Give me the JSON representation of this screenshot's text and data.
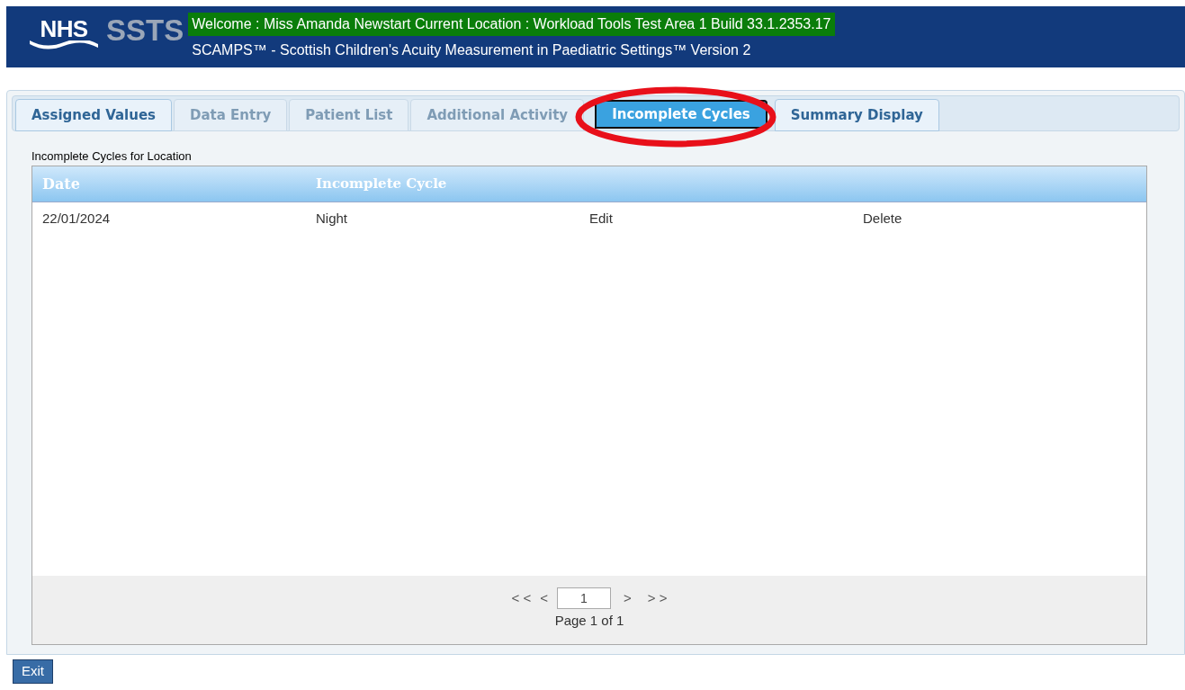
{
  "header": {
    "logo_nhs": "NHS",
    "logo_app": "SSTS",
    "welcome": "Welcome : Miss Amanda Newstart Current Location : Workload Tools Test Area 1 Build 33.1.2353.17",
    "subtitle": "SCAMPS™ - Scottish Children's Acuity Measurement in Paediatric Settings™ Version 2"
  },
  "tabs": [
    {
      "label": "Assigned Values",
      "selected": false,
      "disabled": false
    },
    {
      "label": "Data Entry",
      "selected": false,
      "disabled": true
    },
    {
      "label": "Patient List",
      "selected": false,
      "disabled": true
    },
    {
      "label": "Additional Activity",
      "selected": false,
      "disabled": true
    },
    {
      "label": "Incomplete Cycles",
      "selected": true,
      "disabled": false
    },
    {
      "label": "Summary Display",
      "selected": false,
      "disabled": false
    }
  ],
  "section_title": "Incomplete Cycles for Location",
  "table": {
    "columns": [
      "Date",
      "Incomplete Cycle"
    ],
    "rows": [
      {
        "date": "22/01/2024",
        "cycle": "Night",
        "edit": "Edit",
        "delete": "Delete"
      }
    ]
  },
  "pager": {
    "first": "< <",
    "prev": "<",
    "page_value": "1",
    "next": ">",
    "last": "> >",
    "page_text": "Page 1 of 1"
  },
  "exit_button": "Exit"
}
